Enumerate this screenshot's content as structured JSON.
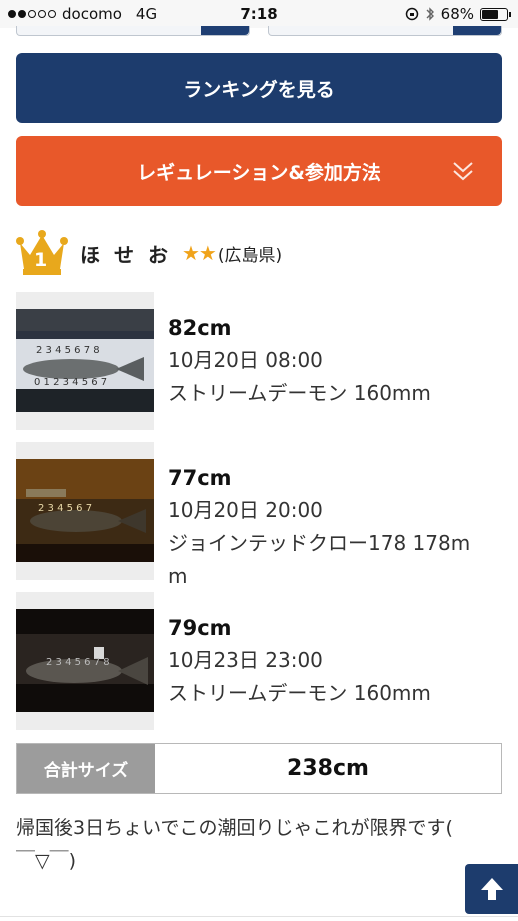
{
  "status_bar": {
    "carrier": "docomo",
    "network": "4G",
    "time": "7:18",
    "battery": "68%",
    "battery_level": 0.68,
    "signal_bars_filled": 2,
    "signal_bars_total": 5
  },
  "buttons": {
    "ranking": "ランキングを見る",
    "regulation": "レギュレーション&参加方法"
  },
  "user": {
    "rank": "1",
    "name": "ほせお",
    "stars": "★★",
    "prefecture": "(広島県)"
  },
  "catches": [
    {
      "size": "82cm",
      "datetime": "10月20日 08:00",
      "lure_line1": "ストリームデーモン 160mm",
      "lure_line2": ""
    },
    {
      "size": "77cm",
      "datetime": "10月20日 20:00",
      "lure_line1": "ジョインテッドクロー178 178m",
      "lure_line2": "m"
    },
    {
      "size": "79cm",
      "datetime": "10月23日 23:00",
      "lure_line1": "ストリームデーモン 160mm",
      "lure_line2": ""
    }
  ],
  "total": {
    "label": "合計サイズ",
    "value": "238cm"
  },
  "comment": {
    "line1": "帰国後3日ちょいでこの潮回りじゃこれが限界です(",
    "line2": "￣▽￣)"
  },
  "colors": {
    "navy": "#1d3c6d",
    "orange": "#e8582a",
    "gold": "#e8a81c",
    "star": "#f0a31a"
  },
  "icons": [
    "crown-icon",
    "chevron-down-icon",
    "arrow-up-icon",
    "bluetooth-icon",
    "rotation-lock-icon"
  ]
}
